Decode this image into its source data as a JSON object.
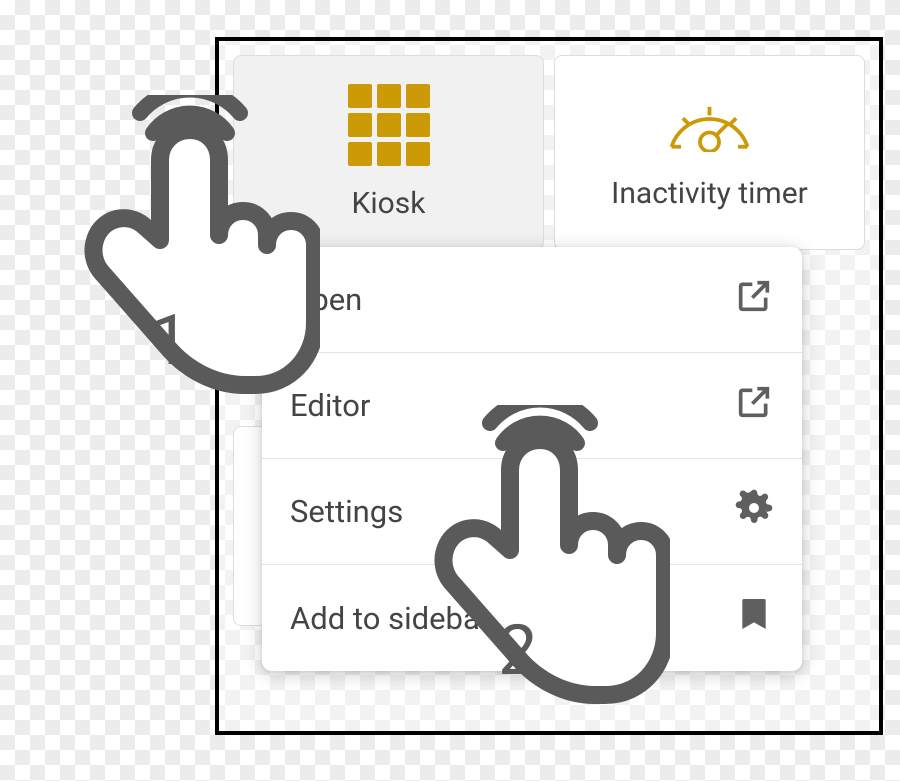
{
  "cards": {
    "kiosk": {
      "label": "Kiosk",
      "icon": "grid-3x3"
    },
    "inactivity": {
      "label": "Inactivity timer",
      "icon": "gauge"
    }
  },
  "menu": {
    "items": [
      {
        "label": "Open",
        "icon": "external-link"
      },
      {
        "label": "Editor",
        "icon": "external-link"
      },
      {
        "label": "Settings",
        "icon": "gear"
      },
      {
        "label": "Add to sidebar",
        "icon": "bookmark"
      }
    ]
  },
  "annotations": {
    "step1": "1",
    "step2": "2"
  },
  "colors": {
    "accent": "#cc9a06",
    "icon_gray": "#5f5f5f"
  }
}
